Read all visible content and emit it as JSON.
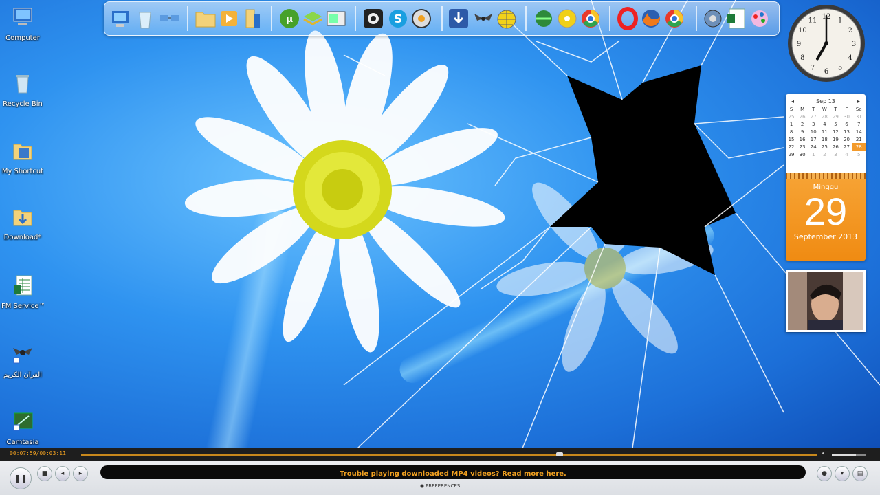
{
  "desktop_icons": [
    {
      "label": "Computer",
      "icon": "computer-icon"
    },
    {
      "label": "Recycle Bin",
      "icon": "recycle-bin-icon"
    },
    {
      "label": "My Shortcut",
      "icon": "folder-icon"
    },
    {
      "label": "Download*",
      "icon": "folder-download-icon"
    },
    {
      "label": "FM Service™",
      "icon": "spreadsheet-icon"
    },
    {
      "label": "القرآن الكريم",
      "icon": "winged-app-icon"
    },
    {
      "label": "Camtasia",
      "icon": "camtasia-icon"
    }
  ],
  "dock_icons": [
    "computer-icon",
    "recycle-bin-icon",
    "network-icon",
    "folder-icon",
    "media-player-icon",
    "folder-icon",
    "utorrent-icon",
    "bluestacks-icon",
    "window-icon",
    "webcam-icon",
    "skype-icon",
    "media-icon",
    "download-icon",
    "app-icon",
    "globe-icon",
    "network-icon",
    "cd-icon",
    "chrome-icon",
    "opera-icon",
    "firefox-icon",
    "chrome-icon",
    "settings-icon",
    "spreadsheet-icon",
    "paint-icon"
  ],
  "calendar": {
    "month_label": "Sep 13",
    "weekdays": [
      "S",
      "M",
      "T",
      "W",
      "T",
      "F",
      "Sa"
    ],
    "weeks": [
      [
        "25",
        "26",
        "27",
        "28",
        "29",
        "30",
        "31"
      ],
      [
        "1",
        "2",
        "3",
        "4",
        "5",
        "6",
        "7"
      ],
      [
        "8",
        "9",
        "10",
        "11",
        "12",
        "13",
        "14"
      ],
      [
        "15",
        "16",
        "17",
        "18",
        "19",
        "20",
        "21"
      ],
      [
        "22",
        "23",
        "24",
        "25",
        "26",
        "27",
        "28"
      ],
      [
        "29",
        "30",
        "1",
        "2",
        "3",
        "4",
        "5"
      ]
    ],
    "day_name": "Minggu",
    "day_number": "29",
    "month_year": "September 2013"
  },
  "clock": {
    "hour": 7,
    "minute": 0
  },
  "player": {
    "time": "00:07:59/00:03:11",
    "progress": 0.65,
    "volume": 0.7,
    "message": "Trouble playing downloaded MP4 videos? Read more here.",
    "preferences_label": "PREFERENCES"
  },
  "colors": {
    "accent": "#f0a020",
    "calendar_orange": "#f39a2b"
  }
}
